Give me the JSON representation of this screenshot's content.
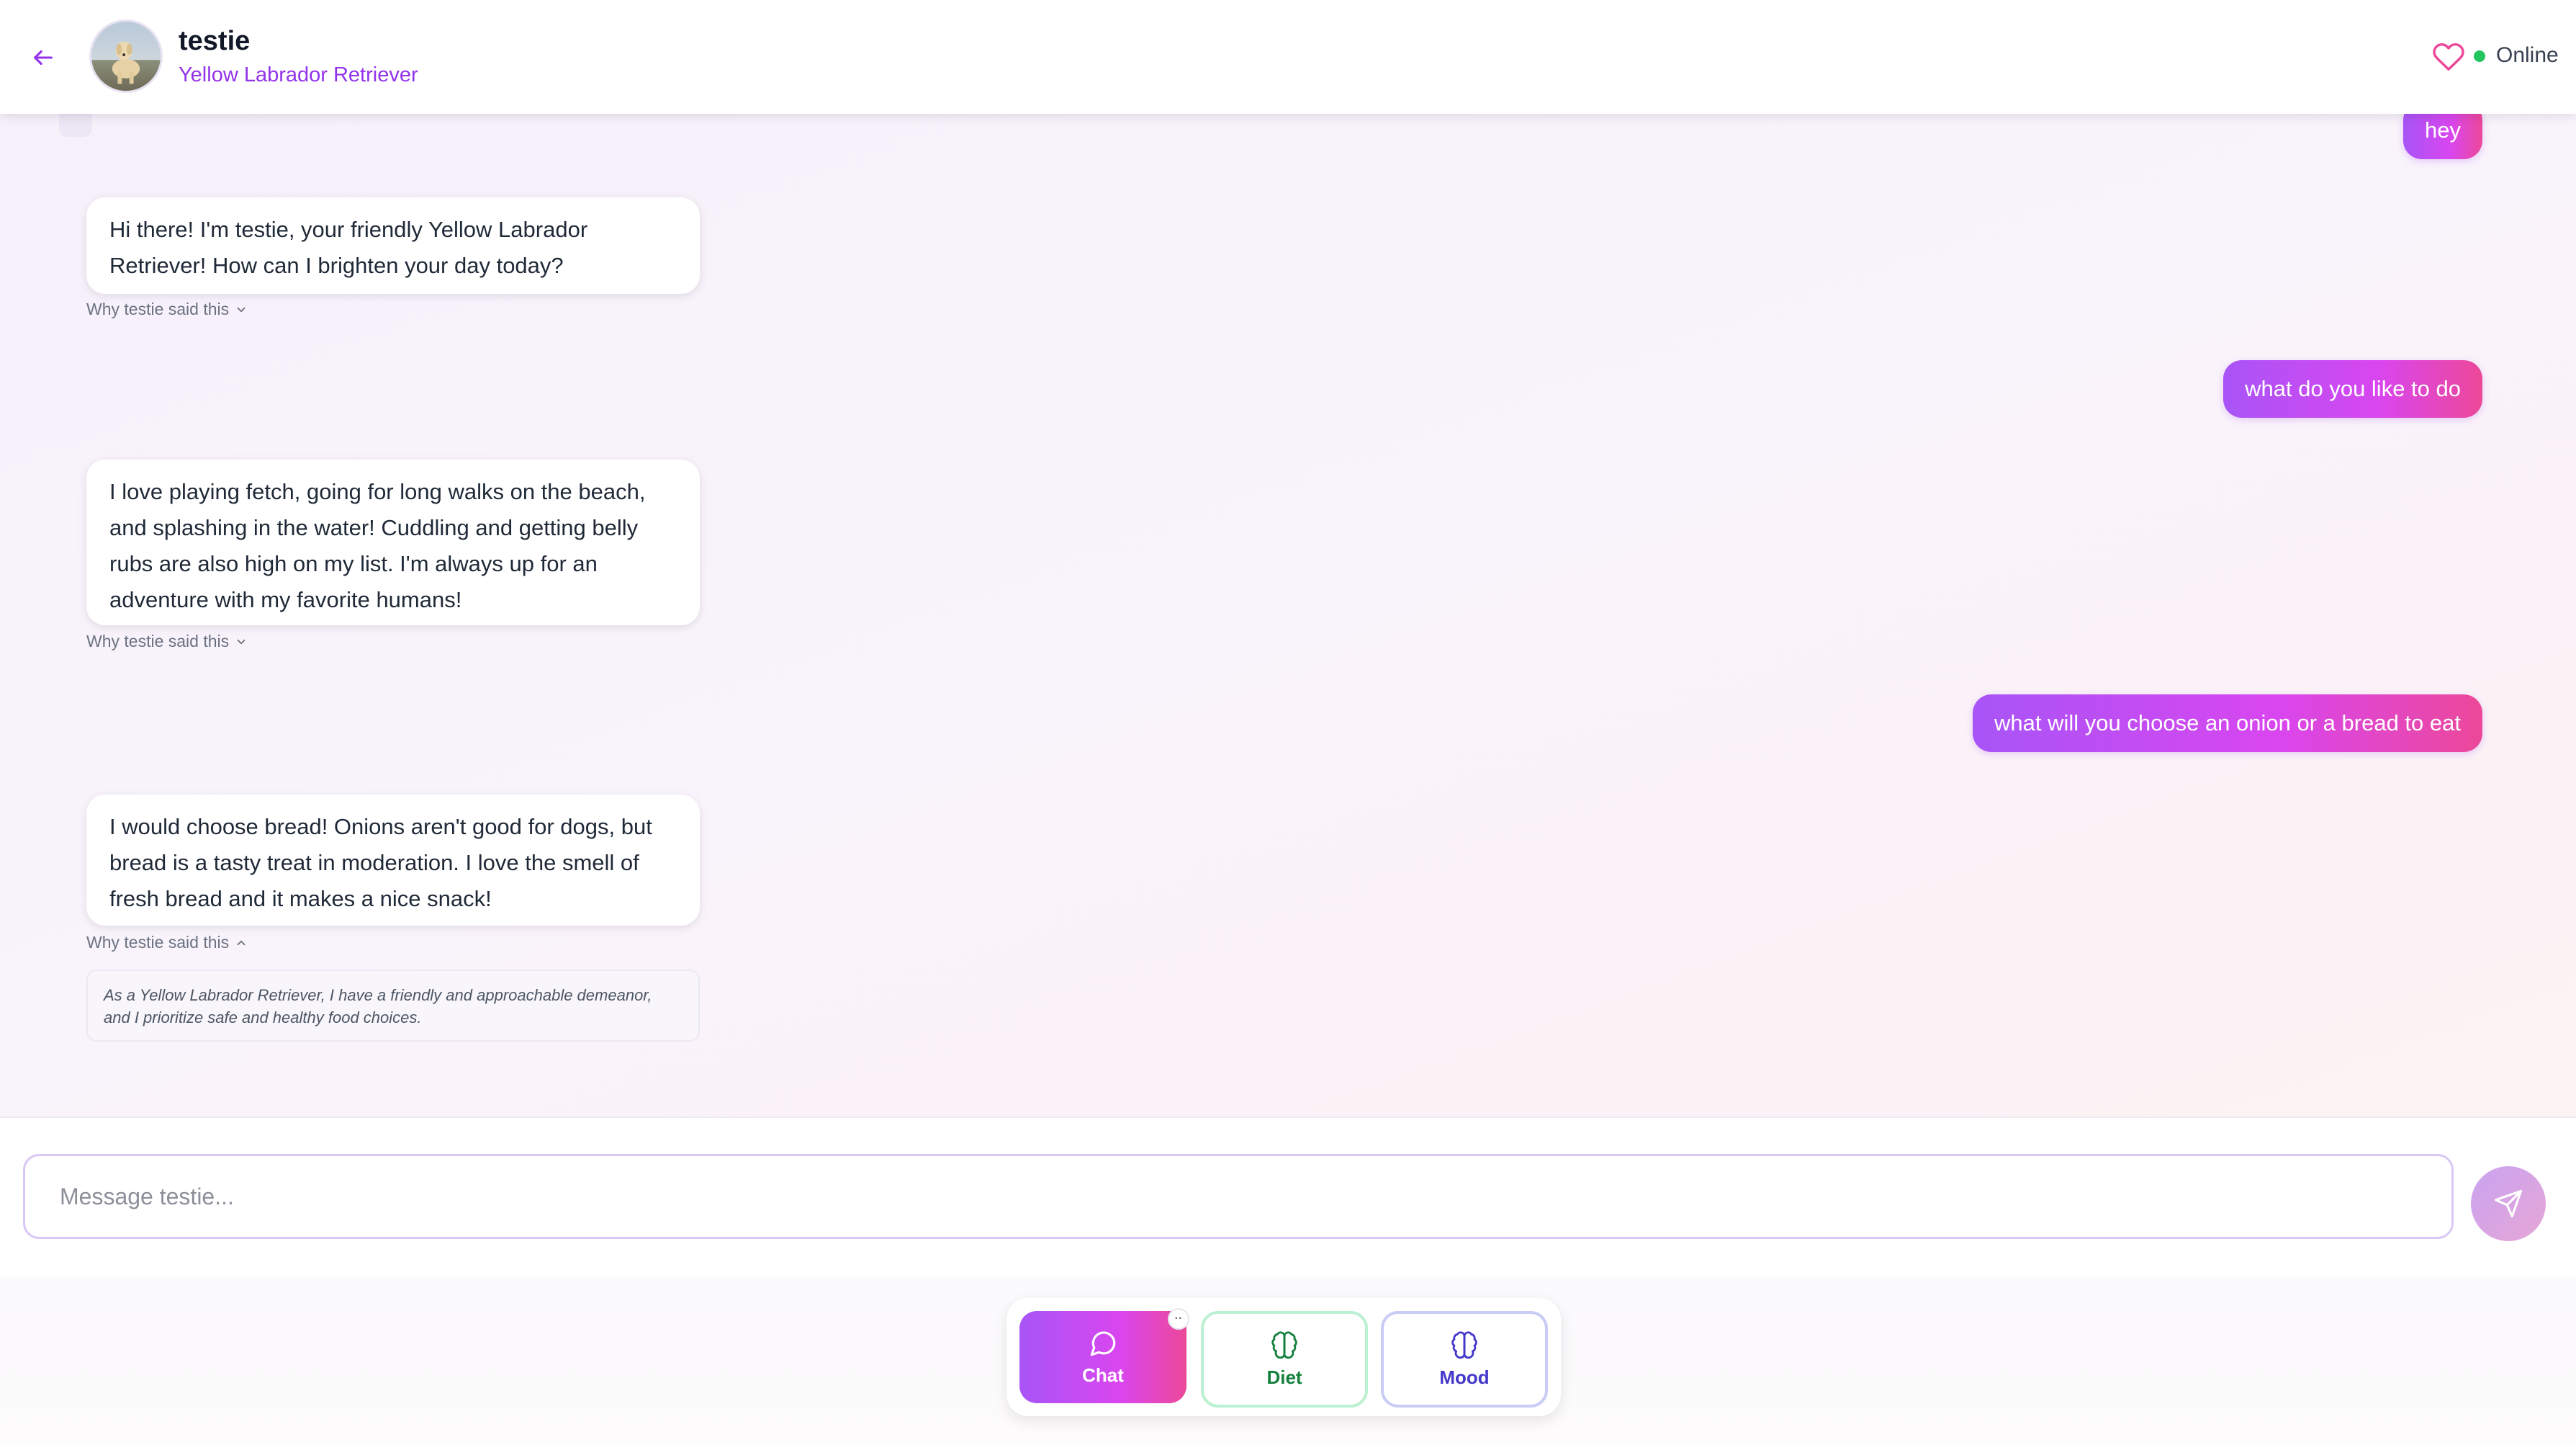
{
  "header": {
    "pet_name": "testie",
    "breed": "Yellow Labrador Retriever",
    "status": "Online",
    "accent_color": "#9333ea",
    "status_color": "#22c55e"
  },
  "messages": [
    {
      "role": "user",
      "text": "hey"
    },
    {
      "role": "bot",
      "text": "Hi there! I'm testie, your friendly Yellow Labrador Retriever! How can I brighten your day today?",
      "why_label": "Why testie said this"
    },
    {
      "role": "user",
      "text": "what do you like to do"
    },
    {
      "role": "bot",
      "text": "I love playing fetch, going for long walks on the beach, and splashing in the water! Cuddling and getting belly rubs are also high on my list. I'm always up for an adventure with my favorite humans!",
      "why_label": "Why testie said this"
    },
    {
      "role": "user",
      "text": "what will you choose an onion or a bread to eat"
    },
    {
      "role": "bot",
      "text": "I would choose bread! Onions aren't good for dogs, but bread is a tasty treat in moderation. I love the smell of fresh bread and it makes a nice snack!",
      "why_label": "Why testie said this",
      "explanation": "As a Yellow Labrador Retriever, I have a friendly and approachable demeanor, and I prioritize safe and healthy food choices."
    }
  ],
  "composer": {
    "placeholder": "Message testie..."
  },
  "tabs": [
    {
      "label": "Chat",
      "icon": "chat-bubble-icon",
      "active": true,
      "badge": "··"
    },
    {
      "label": "Diet",
      "icon": "brain-icon",
      "active": false
    },
    {
      "label": "Mood",
      "icon": "brain-icon",
      "active": false
    }
  ],
  "colors": {
    "gradient_start": "#a855f7",
    "gradient_end": "#ec4899",
    "diet_color": "#15803d",
    "mood_color": "#4338ca"
  }
}
